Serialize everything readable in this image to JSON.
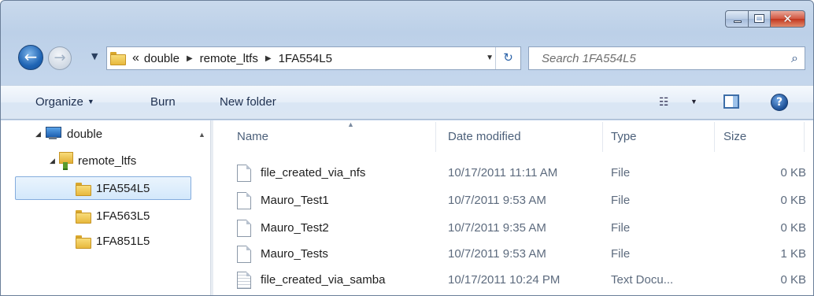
{
  "window": {
    "caption": {
      "minimize": "minimize",
      "maximize": "maximize",
      "close": "close"
    }
  },
  "nav": {
    "back_icon": "back-arrow-icon",
    "forward_icon": "forward-arrow-icon",
    "address": {
      "overflow": "«",
      "crumbs": [
        "double",
        "remote_ltfs",
        "1FA554L5"
      ]
    },
    "search_placeholder": "Search 1FA554L5"
  },
  "toolbar": {
    "organize": "Organize",
    "burn": "Burn",
    "new_folder": "New folder"
  },
  "tree": [
    {
      "label": "double",
      "icon": "computer-icon"
    },
    {
      "label": "remote_ltfs",
      "icon": "network-folder-icon"
    },
    {
      "label": "1FA554L5",
      "icon": "folder-icon",
      "selected": true
    },
    {
      "label": "1FA563L5",
      "icon": "folder-icon"
    },
    {
      "label": "1FA851L5",
      "icon": "folder-icon"
    }
  ],
  "columns": {
    "name": "Name",
    "date": "Date modified",
    "type": "Type",
    "size": "Size"
  },
  "files": [
    {
      "name": "file_created_via_nfs",
      "date": "10/17/2011 11:11 AM",
      "type": "File",
      "size": "0 KB",
      "icon": "file-icon"
    },
    {
      "name": "Mauro_Test1",
      "date": "10/7/2011 9:53 AM",
      "type": "File",
      "size": "0 KB",
      "icon": "file-icon"
    },
    {
      "name": "Mauro_Test2",
      "date": "10/7/2011 9:35 AM",
      "type": "File",
      "size": "0 KB",
      "icon": "file-icon"
    },
    {
      "name": "Mauro_Tests",
      "date": "10/7/2011 9:53 AM",
      "type": "File",
      "size": "1 KB",
      "icon": "file-icon"
    },
    {
      "name": "file_created_via_samba",
      "date": "10/17/2011 10:24 PM",
      "type": "Text Docu...",
      "size": "0 KB",
      "icon": "text-file-icon"
    }
  ]
}
